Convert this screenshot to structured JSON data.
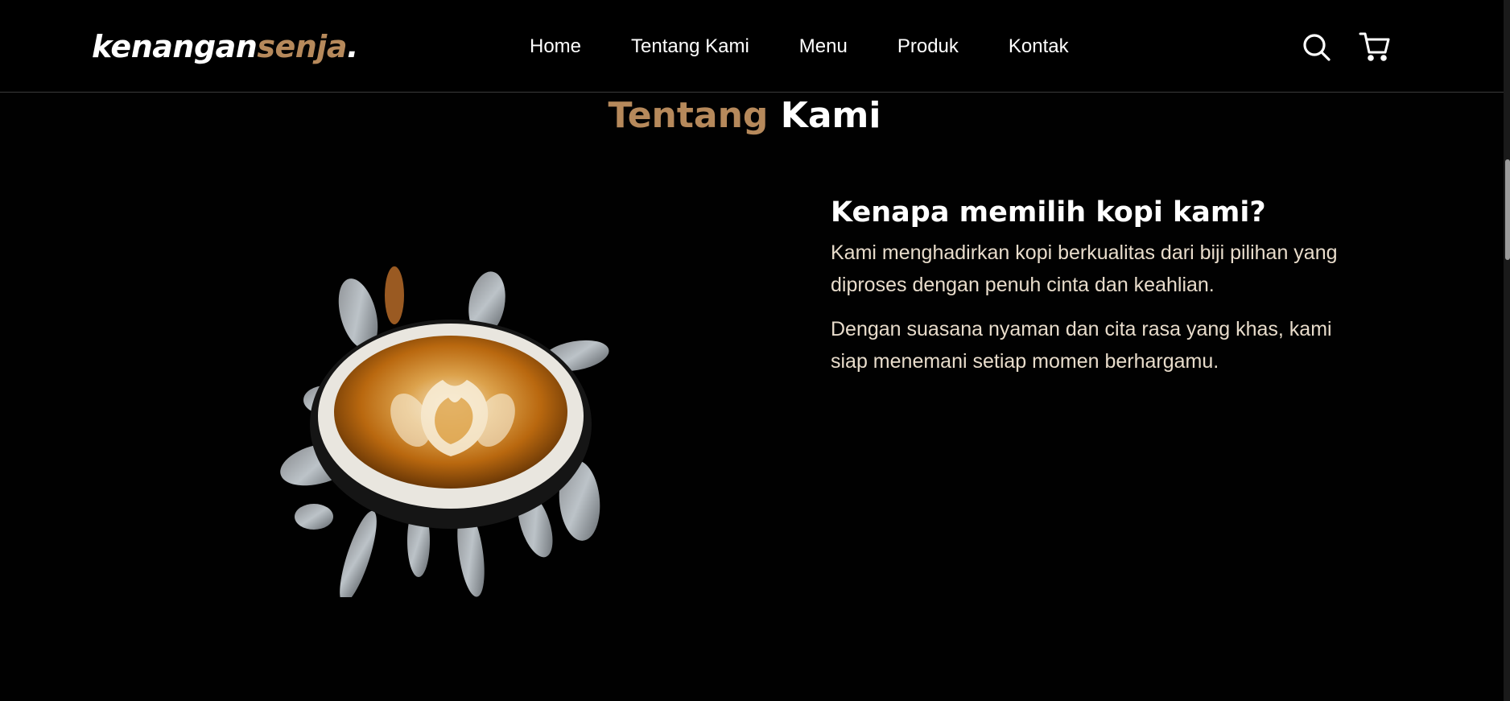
{
  "logo": {
    "part1": "kenangan",
    "part2": "senja",
    "dot": "."
  },
  "nav": {
    "links": [
      "Home",
      "Tentang Kami",
      "Menu",
      "Produk",
      "Kontak"
    ]
  },
  "icons": {
    "search": "search-icon",
    "cart": "shopping-cart-icon"
  },
  "about": {
    "title_accent": "Tentang",
    "title_rest": "Kami",
    "heading": "Kenapa memilih kopi kami?",
    "paragraphs": [
      "Kami menghadirkan kopi berkualitas dari biji pilihan yang diproses dengan penuh cinta dan keahlian.",
      "Dengan suasana nyaman dan cita rasa yang khas, kami siap menemani setiap momen berhargamu."
    ]
  },
  "colors": {
    "accent": "#b6895b",
    "background": "#010101",
    "text": "#ffffff"
  }
}
